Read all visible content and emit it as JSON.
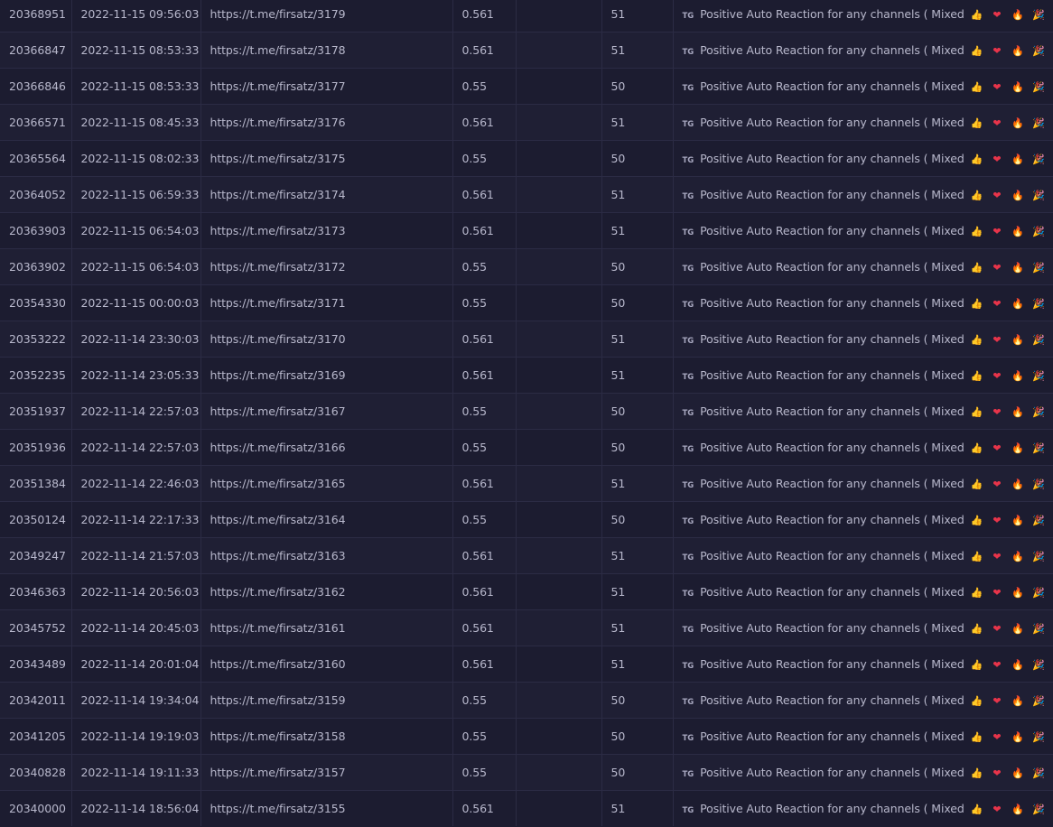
{
  "service": {
    "badge": "TG",
    "text_before": "Positive Auto Reaction for any channels ( Mixed",
    "text_after": ")",
    "emoji_icons": [
      "thumbs-up-icon",
      "heart-icon",
      "fire-icon",
      "party-popper-icon",
      "star-struck-icon",
      "grimace-icon"
    ],
    "thumb": "👍",
    "heart": "❤",
    "fire": "🔥",
    "party": "🎉"
  },
  "orders": [
    {
      "id": "20368951",
      "date": "2022-11-15 09:56:03",
      "link": "https://t.me/firsatz/3179",
      "charge": "0.561",
      "start": "",
      "quantity": "51"
    },
    {
      "id": "20366847",
      "date": "2022-11-15 08:53:33",
      "link": "https://t.me/firsatz/3178",
      "charge": "0.561",
      "start": "",
      "quantity": "51"
    },
    {
      "id": "20366846",
      "date": "2022-11-15 08:53:33",
      "link": "https://t.me/firsatz/3177",
      "charge": "0.55",
      "start": "",
      "quantity": "50"
    },
    {
      "id": "20366571",
      "date": "2022-11-15 08:45:33",
      "link": "https://t.me/firsatz/3176",
      "charge": "0.561",
      "start": "",
      "quantity": "51"
    },
    {
      "id": "20365564",
      "date": "2022-11-15 08:02:33",
      "link": "https://t.me/firsatz/3175",
      "charge": "0.55",
      "start": "",
      "quantity": "50"
    },
    {
      "id": "20364052",
      "date": "2022-11-15 06:59:33",
      "link": "https://t.me/firsatz/3174",
      "charge": "0.561",
      "start": "",
      "quantity": "51"
    },
    {
      "id": "20363903",
      "date": "2022-11-15 06:54:03",
      "link": "https://t.me/firsatz/3173",
      "charge": "0.561",
      "start": "",
      "quantity": "51"
    },
    {
      "id": "20363902",
      "date": "2022-11-15 06:54:03",
      "link": "https://t.me/firsatz/3172",
      "charge": "0.55",
      "start": "",
      "quantity": "50"
    },
    {
      "id": "20354330",
      "date": "2022-11-15 00:00:03",
      "link": "https://t.me/firsatz/3171",
      "charge": "0.55",
      "start": "",
      "quantity": "50"
    },
    {
      "id": "20353222",
      "date": "2022-11-14 23:30:03",
      "link": "https://t.me/firsatz/3170",
      "charge": "0.561",
      "start": "",
      "quantity": "51"
    },
    {
      "id": "20352235",
      "date": "2022-11-14 23:05:33",
      "link": "https://t.me/firsatz/3169",
      "charge": "0.561",
      "start": "",
      "quantity": "51"
    },
    {
      "id": "20351937",
      "date": "2022-11-14 22:57:03",
      "link": "https://t.me/firsatz/3167",
      "charge": "0.55",
      "start": "",
      "quantity": "50"
    },
    {
      "id": "20351936",
      "date": "2022-11-14 22:57:03",
      "link": "https://t.me/firsatz/3166",
      "charge": "0.55",
      "start": "",
      "quantity": "50"
    },
    {
      "id": "20351384",
      "date": "2022-11-14 22:46:03",
      "link": "https://t.me/firsatz/3165",
      "charge": "0.561",
      "start": "",
      "quantity": "51"
    },
    {
      "id": "20350124",
      "date": "2022-11-14 22:17:33",
      "link": "https://t.me/firsatz/3164",
      "charge": "0.55",
      "start": "",
      "quantity": "50"
    },
    {
      "id": "20349247",
      "date": "2022-11-14 21:57:03",
      "link": "https://t.me/firsatz/3163",
      "charge": "0.561",
      "start": "",
      "quantity": "51"
    },
    {
      "id": "20346363",
      "date": "2022-11-14 20:56:03",
      "link": "https://t.me/firsatz/3162",
      "charge": "0.561",
      "start": "",
      "quantity": "51"
    },
    {
      "id": "20345752",
      "date": "2022-11-14 20:45:03",
      "link": "https://t.me/firsatz/3161",
      "charge": "0.561",
      "start": "",
      "quantity": "51"
    },
    {
      "id": "20343489",
      "date": "2022-11-14 20:01:04",
      "link": "https://t.me/firsatz/3160",
      "charge": "0.561",
      "start": "",
      "quantity": "51"
    },
    {
      "id": "20342011",
      "date": "2022-11-14 19:34:04",
      "link": "https://t.me/firsatz/3159",
      "charge": "0.55",
      "start": "",
      "quantity": "50"
    },
    {
      "id": "20341205",
      "date": "2022-11-14 19:19:03",
      "link": "https://t.me/firsatz/3158",
      "charge": "0.55",
      "start": "",
      "quantity": "50"
    },
    {
      "id": "20340828",
      "date": "2022-11-14 19:11:33",
      "link": "https://t.me/firsatz/3157",
      "charge": "0.55",
      "start": "",
      "quantity": "50"
    },
    {
      "id": "20340000",
      "date": "2022-11-14 18:56:04",
      "link": "https://t.me/firsatz/3155",
      "charge": "0.561",
      "start": "",
      "quantity": "51"
    }
  ]
}
